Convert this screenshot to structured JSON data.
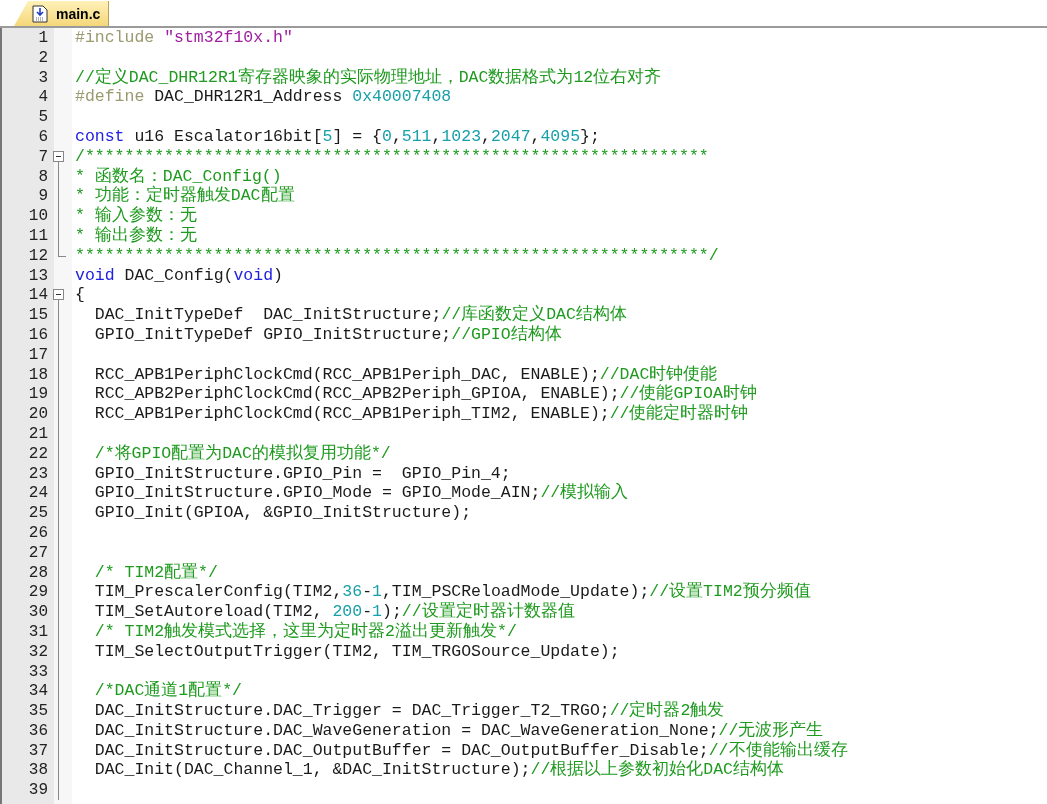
{
  "tab": {
    "label": "main.c",
    "selected": true
  },
  "lines": [
    {
      "number": "1",
      "kind": "code",
      "tokens": [
        {
          "kind": "preproc",
          "text": "#include "
        },
        {
          "kind": "string",
          "text": "\"stm32f10x.h\""
        }
      ]
    },
    {
      "number": "2",
      "kind": "code"
    },
    {
      "number": "3",
      "kind": "code",
      "tokens": [
        {
          "kind": "comment",
          "text": "//定义DAC_DHR12R1寄存器映象的实际物理地址，DAC数据格式为12位右对齐"
        }
      ]
    },
    {
      "number": "4",
      "kind": "code",
      "tokens": [
        {
          "kind": "preproc",
          "text": "#define"
        },
        {
          "kind": "plain",
          "text": " DAC_DHR12R1_Address "
        },
        {
          "kind": "number",
          "text": "0x40007408"
        }
      ]
    },
    {
      "number": "5",
      "kind": "code"
    },
    {
      "number": "6",
      "kind": "code",
      "tokens": [
        {
          "kind": "keyword",
          "text": "const"
        },
        {
          "kind": "plain",
          "text": " u16 Escalator16bit["
        },
        {
          "kind": "number",
          "text": "5"
        },
        {
          "kind": "plain",
          "text": "] = {"
        },
        {
          "kind": "number",
          "text": "0"
        },
        {
          "kind": "plain",
          "text": ","
        },
        {
          "kind": "number",
          "text": "511"
        },
        {
          "kind": "plain",
          "text": ","
        },
        {
          "kind": "number",
          "text": "1023"
        },
        {
          "kind": "plain",
          "text": ","
        },
        {
          "kind": "number",
          "text": "2047"
        },
        {
          "kind": "plain",
          "text": ","
        },
        {
          "kind": "number",
          "text": "4095"
        },
        {
          "kind": "plain",
          "text": "};"
        }
      ]
    },
    {
      "number": "7",
      "kind": "fold_start",
      "tokens": [
        {
          "kind": "comment",
          "text": "/***************************************************************"
        }
      ]
    },
    {
      "number": "8",
      "kind": "fold_body",
      "tokens": [
        {
          "kind": "comment",
          "text": "* 函数名：DAC_Config()"
        }
      ]
    },
    {
      "number": "9",
      "kind": "fold_body",
      "tokens": [
        {
          "kind": "comment",
          "text": "* 功能：定时器触发DAC配置"
        }
      ]
    },
    {
      "number": "10",
      "kind": "fold_body",
      "tokens": [
        {
          "kind": "comment",
          "text": "* 输入参数：无"
        }
      ]
    },
    {
      "number": "11",
      "kind": "fold_body",
      "tokens": [
        {
          "kind": "comment",
          "text": "* 输出参数：无"
        }
      ]
    },
    {
      "number": "12",
      "kind": "fold_end",
      "tokens": [
        {
          "kind": "comment",
          "text": "****************************************************************/"
        }
      ]
    },
    {
      "number": "13",
      "kind": "code",
      "tokens": [
        {
          "kind": "keyword",
          "text": "void"
        },
        {
          "kind": "plain",
          "text": " DAC_Config("
        },
        {
          "kind": "keyword",
          "text": "void"
        },
        {
          "kind": "plain",
          "text": ")"
        }
      ]
    },
    {
      "number": "14",
      "kind": "fold_start",
      "tokens": [
        {
          "kind": "plain",
          "text": "{"
        }
      ]
    },
    {
      "number": "15",
      "kind": "fold_body",
      "tokens": [
        {
          "kind": "plain",
          "text": "  DAC_InitTypeDef  DAC_InitStructure;"
        },
        {
          "kind": "comment",
          "text": "//库函数定义DAC结构体"
        }
      ]
    },
    {
      "number": "16",
      "kind": "fold_body",
      "tokens": [
        {
          "kind": "plain",
          "text": "  GPIO_InitTypeDef GPIO_InitStructure;"
        },
        {
          "kind": "comment",
          "text": "//GPIO结构体"
        }
      ]
    },
    {
      "number": "17",
      "kind": "fold_body"
    },
    {
      "number": "18",
      "kind": "fold_body",
      "tokens": [
        {
          "kind": "plain",
          "text": "  RCC_APB1PeriphClockCmd(RCC_APB1Periph_DAC, ENABLE);"
        },
        {
          "kind": "comment",
          "text": "//DAC时钟使能"
        }
      ]
    },
    {
      "number": "19",
      "kind": "fold_body",
      "tokens": [
        {
          "kind": "plain",
          "text": "  RCC_APB2PeriphClockCmd(RCC_APB2Periph_GPIOA, ENABLE);"
        },
        {
          "kind": "comment",
          "text": "//使能GPIOA时钟"
        }
      ]
    },
    {
      "number": "20",
      "kind": "fold_body",
      "tokens": [
        {
          "kind": "plain",
          "text": "  RCC_APB1PeriphClockCmd(RCC_APB1Periph_TIM2, ENABLE);"
        },
        {
          "kind": "comment",
          "text": "//使能定时器时钟"
        }
      ]
    },
    {
      "number": "21",
      "kind": "fold_body"
    },
    {
      "number": "22",
      "kind": "fold_body",
      "tokens": [
        {
          "kind": "comment",
          "text": "  /*将GPIO配置为DAC的模拟复用功能*/"
        }
      ]
    },
    {
      "number": "23",
      "kind": "fold_body",
      "tokens": [
        {
          "kind": "plain",
          "text": "  GPIO_InitStructure.GPIO_Pin =  GPIO_Pin_4;"
        }
      ]
    },
    {
      "number": "24",
      "kind": "fold_body",
      "tokens": [
        {
          "kind": "plain",
          "text": "  GPIO_InitStructure.GPIO_Mode = GPIO_Mode_AIN;"
        },
        {
          "kind": "comment",
          "text": "//模拟输入"
        }
      ]
    },
    {
      "number": "25",
      "kind": "fold_body",
      "tokens": [
        {
          "kind": "plain",
          "text": "  GPIO_Init(GPIOA, &GPIO_InitStructure);"
        }
      ]
    },
    {
      "number": "26",
      "kind": "fold_body"
    },
    {
      "number": "27",
      "kind": "fold_body"
    },
    {
      "number": "28",
      "kind": "fold_body",
      "tokens": [
        {
          "kind": "comment",
          "text": "  /* TIM2配置*/"
        }
      ]
    },
    {
      "number": "29",
      "kind": "fold_body",
      "tokens": [
        {
          "kind": "plain",
          "text": "  TIM_PrescalerConfig(TIM2,"
        },
        {
          "kind": "number",
          "text": "36"
        },
        {
          "kind": "plain",
          "text": "-"
        },
        {
          "kind": "number",
          "text": "1"
        },
        {
          "kind": "plain",
          "text": ",TIM_PSCReloadMode_Update);"
        },
        {
          "kind": "comment",
          "text": "//设置TIM2预分频值"
        }
      ]
    },
    {
      "number": "30",
      "kind": "fold_body",
      "tokens": [
        {
          "kind": "plain",
          "text": "  TIM_SetAutoreload(TIM2, "
        },
        {
          "kind": "number",
          "text": "200"
        },
        {
          "kind": "plain",
          "text": "-"
        },
        {
          "kind": "number",
          "text": "1"
        },
        {
          "kind": "plain",
          "text": ");"
        },
        {
          "kind": "comment",
          "text": "//设置定时器计数器值"
        }
      ]
    },
    {
      "number": "31",
      "kind": "fold_body",
      "tokens": [
        {
          "kind": "comment",
          "text": "  /* TIM2触发模式选择，这里为定时器2溢出更新触发*/"
        }
      ]
    },
    {
      "number": "32",
      "kind": "fold_body",
      "tokens": [
        {
          "kind": "plain",
          "text": "  TIM_SelectOutputTrigger(TIM2, TIM_TRGOSource_Update);"
        }
      ]
    },
    {
      "number": "33",
      "kind": "fold_body"
    },
    {
      "number": "34",
      "kind": "fold_body",
      "tokens": [
        {
          "kind": "comment",
          "text": "  /*DAC通道1配置*/"
        }
      ]
    },
    {
      "number": "35",
      "kind": "fold_body",
      "tokens": [
        {
          "kind": "plain",
          "text": "  DAC_InitStructure.DAC_Trigger = DAC_Trigger_T2_TRGO;"
        },
        {
          "kind": "comment",
          "text": "//定时器2触发"
        }
      ]
    },
    {
      "number": "36",
      "kind": "fold_body",
      "tokens": [
        {
          "kind": "plain",
          "text": "  DAC_InitStructure.DAC_WaveGeneration = DAC_WaveGeneration_None;"
        },
        {
          "kind": "comment",
          "text": "//无波形产生"
        }
      ]
    },
    {
      "number": "37",
      "kind": "fold_body",
      "tokens": [
        {
          "kind": "plain",
          "text": "  DAC_InitStructure.DAC_OutputBuffer = DAC_OutputBuffer_Disable;"
        },
        {
          "kind": "comment",
          "text": "//不使能输出缓存"
        }
      ]
    },
    {
      "number": "38",
      "kind": "fold_body",
      "tokens": [
        {
          "kind": "plain",
          "text": "  DAC_Init(DAC_Channel_1, &DAC_InitStructure);"
        },
        {
          "kind": "comment",
          "text": "//根据以上参数初始化DAC结构体"
        }
      ]
    },
    {
      "number": "39",
      "kind": "fold_body"
    }
  ]
}
